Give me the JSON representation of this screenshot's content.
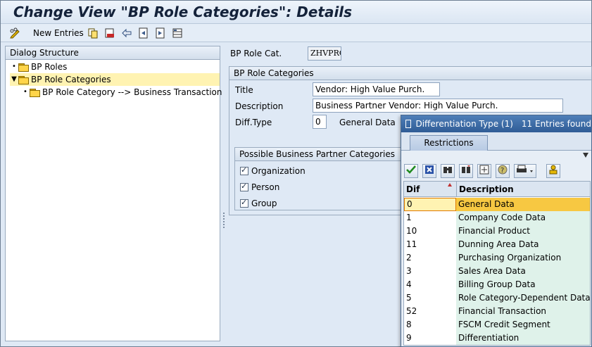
{
  "window": {
    "title": "Change View \"BP Role Categories\": Details"
  },
  "toolbar": {
    "new_entries_label": "New Entries"
  },
  "dialog_structure": {
    "header": "Dialog Structure",
    "items": [
      {
        "label": "BP Roles"
      },
      {
        "label": "BP Role Categories"
      },
      {
        "label": "BP Role Category --> Business Transaction"
      }
    ]
  },
  "form": {
    "role_cat_label": "BP Role Cat.",
    "role_cat_value": "ZHVPRC",
    "group_header": "BP Role Categories",
    "title_label": "Title",
    "title_value": "Vendor: High Value Purch.",
    "description_label": "Description",
    "description_value": "Business Partner Vendor: High Value Purch.",
    "diff_type_label": "Diff.Type",
    "diff_type_value": "0",
    "diff_type_text": "General Data",
    "categories_header": "Possible Business Partner Categories",
    "categories": [
      {
        "label": "Organization",
        "checked": true
      },
      {
        "label": "Person",
        "checked": true
      },
      {
        "label": "Group",
        "checked": true
      }
    ]
  },
  "popup": {
    "title": "Differentiation Type (1)",
    "count": "11 Entries found",
    "tab_label": "Restrictions",
    "col_dif": "Dif",
    "col_description": "Description",
    "rows": [
      {
        "key": "0",
        "desc": "General Data"
      },
      {
        "key": "1",
        "desc": "Company Code Data"
      },
      {
        "key": "10",
        "desc": "Financial Product"
      },
      {
        "key": "11",
        "desc": "Dunning Area Data"
      },
      {
        "key": "2",
        "desc": "Purchasing Organization"
      },
      {
        "key": "3",
        "desc": "Sales Area Data"
      },
      {
        "key": "4",
        "desc": "Billing Group Data"
      },
      {
        "key": "5",
        "desc": "Role Category-Dependent Data"
      },
      {
        "key": "52",
        "desc": "Financial Transaction"
      },
      {
        "key": "8",
        "desc": "FSCM Credit Segment"
      },
      {
        "key": "9",
        "desc": "Differentiation"
      }
    ]
  }
}
